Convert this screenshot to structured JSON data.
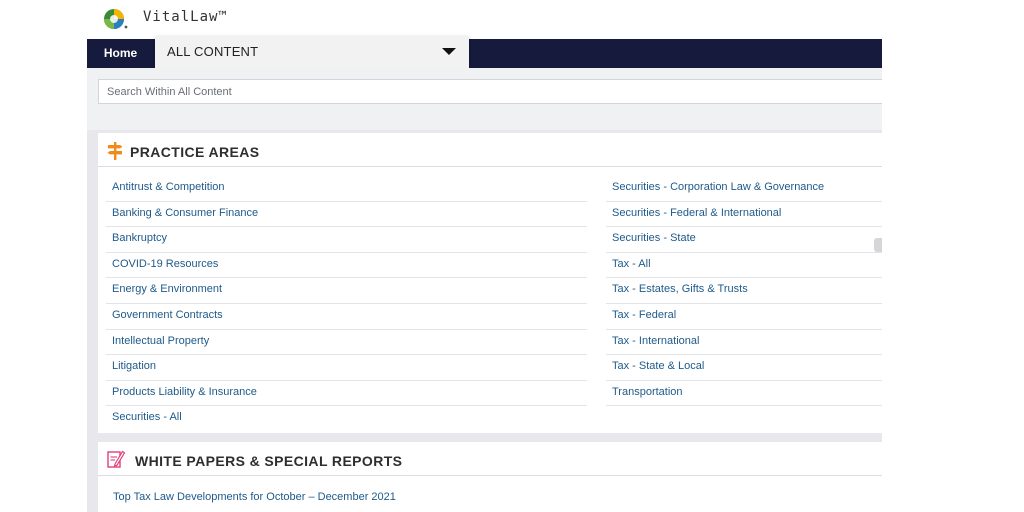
{
  "header": {
    "brand": "VitalLaw™"
  },
  "nav": {
    "home_label": "Home",
    "content_select": "ALL CONTENT"
  },
  "search": {
    "placeholder": "Search Within All Content"
  },
  "practice_areas": {
    "title": "PRACTICE AREAS",
    "left": [
      "Antitrust & Competition",
      "Banking & Consumer Finance",
      "Bankruptcy",
      "COVID-19 Resources",
      "Energy & Environment",
      "Government Contracts",
      "Intellectual Property",
      "Litigation",
      "Products Liability & Insurance",
      "Securities - All"
    ],
    "right": [
      "Securities - Corporation Law & Governance",
      "Securities - Federal & International",
      "Securities - State",
      "Tax - All",
      "Tax - Estates, Gifts & Trusts",
      "Tax - Federal",
      "Tax - International",
      "Tax - State & Local",
      "Transportation"
    ]
  },
  "white_papers": {
    "title": "WHITE PAPERS & SPECIAL REPORTS",
    "items": [
      "Top Tax Law Developments for October – December 2021"
    ]
  },
  "colors": {
    "nav_bg": "#161a3d",
    "link": "#1e5a8a",
    "accent_icon": "#f08a1c",
    "wp_icon": "#e0407a"
  }
}
